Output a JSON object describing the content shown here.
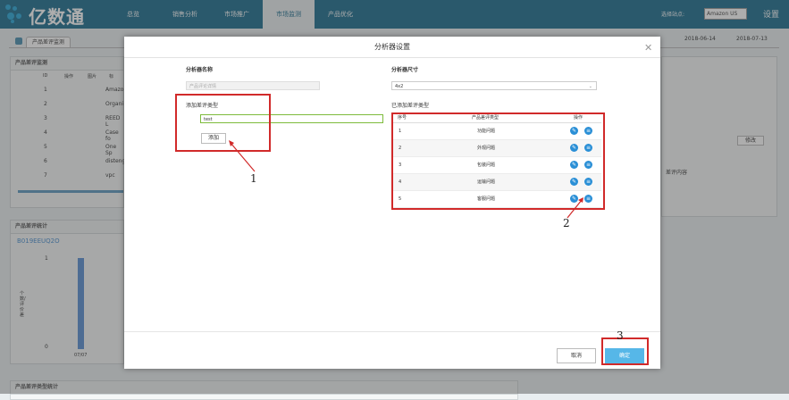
{
  "topbar": {
    "logo": "亿数通",
    "nav": [
      "总览",
      "销售分析",
      "市场推广",
      "市场监测",
      "产品优化"
    ],
    "active_index": 3,
    "site_label": "选择站点:",
    "site_value": "Amazon US",
    "settings_label": "设置"
  },
  "page": {
    "tab": "产品差评监测",
    "date_from": "2018-06-14",
    "date_to": "2018-07-13"
  },
  "background": {
    "panel1_title": "产品差评监测",
    "columns": [
      "ID",
      "操作",
      "图片",
      "标"
    ],
    "rows": [
      {
        "id": "1",
        "text": "Amazo"
      },
      {
        "id": "2",
        "text": "Organi"
      },
      {
        "id": "3",
        "text": "REED L"
      },
      {
        "id": "4",
        "text": "Case fo"
      },
      {
        "id": "5",
        "text": "One Sp"
      },
      {
        "id": "6",
        "text": "disteng"
      },
      {
        "id": "7",
        "text": "vpc"
      }
    ],
    "panel2_title": "产品差评统计",
    "asin": "B019EEUQ2O",
    "y_label": "个数/评价差",
    "chart_x": "07/07",
    "y_ticks": [
      "1",
      "0"
    ],
    "panel3_title": "产品差评类型统计",
    "right_button": "修改",
    "right_note": "差评内容"
  },
  "chart_data": {
    "type": "bar",
    "categories": [
      "07/07"
    ],
    "values": [
      1
    ],
    "ylim": [
      0,
      1
    ]
  },
  "dialog": {
    "title": "分析器设置",
    "name_label": "分析器名称",
    "name_placeholder": "产品评论详情",
    "size_label": "分析器尺寸",
    "size_value": "4x2",
    "add_label": "添加差评类型",
    "add_input_value": "test",
    "add_button": "添加",
    "added_label": "已添加差评类型",
    "table_headers": [
      "序号",
      "产品差评类型",
      "操作"
    ],
    "table_rows": [
      {
        "no": "1",
        "type": "功能问题"
      },
      {
        "no": "2",
        "type": "外观问题"
      },
      {
        "no": "3",
        "type": "包装问题"
      },
      {
        "no": "4",
        "type": "运输问题"
      },
      {
        "no": "5",
        "type": "客服问题"
      }
    ],
    "cancel": "取消",
    "confirm": "确定"
  },
  "annotations": [
    "1",
    "2",
    "3"
  ]
}
